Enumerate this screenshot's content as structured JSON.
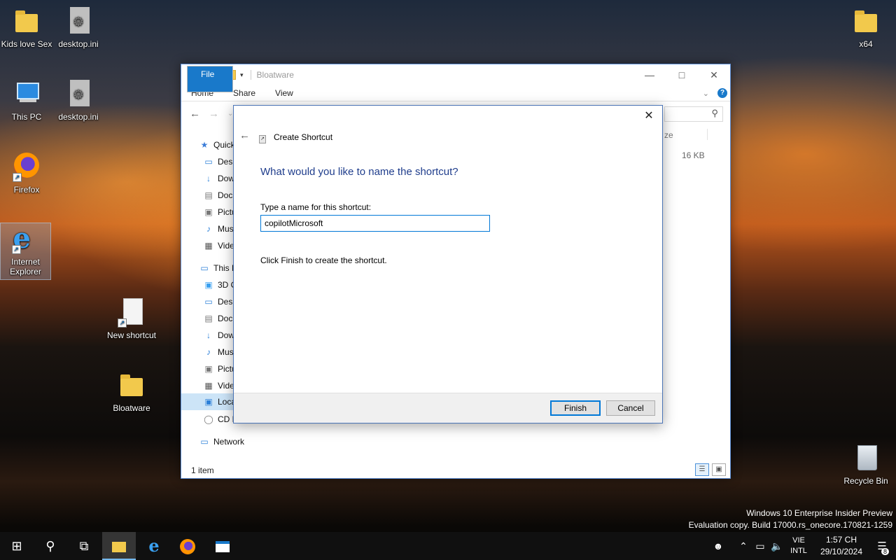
{
  "desktop": {
    "icons": [
      {
        "label": "Kids love Sex"
      },
      {
        "label": "desktop.ini"
      },
      {
        "label": "This PC"
      },
      {
        "label": "desktop.ini"
      },
      {
        "label": "Firefox"
      },
      {
        "label": "Internet Explorer"
      },
      {
        "label": "New shortcut"
      },
      {
        "label": "Bloatware"
      },
      {
        "label": "x64"
      },
      {
        "label": "Recycle Bin"
      }
    ]
  },
  "explorer": {
    "title": "Bloatware",
    "ribbon_tabs": [
      "File",
      "Home",
      "Share",
      "View"
    ],
    "nav_items": [
      "Quick",
      "Desk",
      "Dow",
      "Doc",
      "Pictu",
      "Mus",
      "Vide",
      "This P",
      "3D O",
      "Desk",
      "Doc",
      "Dow",
      "Mus",
      "Pictu",
      "Vide",
      "Loca",
      "CD D",
      "Network"
    ],
    "column_header": "ze",
    "size_value": "16 KB",
    "status": "1 item"
  },
  "dialog": {
    "wizard_title": "Create Shortcut",
    "heading": "What would you like to name the shortcut?",
    "name_label": "Type a name for this shortcut:",
    "name_value": "copilotMicrosoft",
    "info_text": "Click Finish to create the shortcut.",
    "finish_label": "Finish",
    "cancel_label": "Cancel"
  },
  "watermark": {
    "line1": "Windows 10 Enterprise Insider Preview",
    "line2": "Evaluation copy. Build 17000.rs_onecore.170821-1259"
  },
  "taskbar": {
    "lang_line1": "VIE",
    "lang_line2": "INTL",
    "time": "1:57 CH",
    "date": "29/10/2024",
    "notification_count": "8"
  },
  "colors": {
    "accent": "#0078d7",
    "ribbon_file_tab": "#1979ca",
    "dialog_heading": "#1f3d8c"
  }
}
